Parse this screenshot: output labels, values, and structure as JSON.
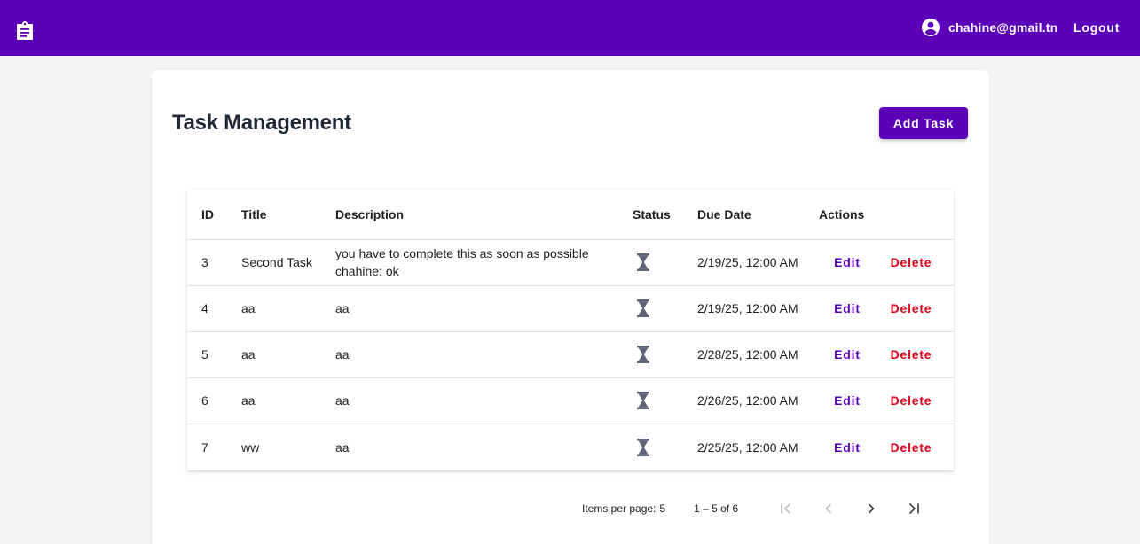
{
  "header": {
    "app_icon": "clipboard-icon",
    "user_icon": "account-circle-icon",
    "user_email": "chahine@gmail.tn",
    "logout_label": "Logout",
    "brand_color": "#5b00b8"
  },
  "page": {
    "title": "Task Management",
    "add_label": "Add Task"
  },
  "table": {
    "columns": [
      "ID",
      "Title",
      "Description",
      "Status",
      "Due Date",
      "Actions"
    ],
    "rows": [
      {
        "id": "3",
        "title": "Second Task",
        "description": "you have to complete this as soon as possible chahine: ok",
        "status_icon": "hourglass-icon",
        "due": "2/19/25, 12:00 AM",
        "edit": "Edit",
        "delete": "Delete"
      },
      {
        "id": "4",
        "title": "aa",
        "description": "aa",
        "status_icon": "hourglass-icon",
        "due": "2/19/25, 12:00 AM",
        "edit": "Edit",
        "delete": "Delete"
      },
      {
        "id": "5",
        "title": "aa",
        "description": "aa",
        "status_icon": "hourglass-icon",
        "due": "2/28/25, 12:00 AM",
        "edit": "Edit",
        "delete": "Delete"
      },
      {
        "id": "6",
        "title": "aa",
        "description": "aa",
        "status_icon": "hourglass-icon",
        "due": "2/26/25, 12:00 AM",
        "edit": "Edit",
        "delete": "Delete"
      },
      {
        "id": "7",
        "title": "ww",
        "description": "aa",
        "status_icon": "hourglass-icon",
        "due": "2/25/25, 12:00 AM",
        "edit": "Edit",
        "delete": "Delete"
      }
    ]
  },
  "paginator": {
    "items_per_page_label": "Items per page:",
    "page_size": "5",
    "range_label": "1 – 5 of 6",
    "first_icon": "first-page-icon",
    "prev_icon": "chevron-left-icon",
    "next_icon": "chevron-right-icon",
    "last_icon": "last-page-icon"
  }
}
